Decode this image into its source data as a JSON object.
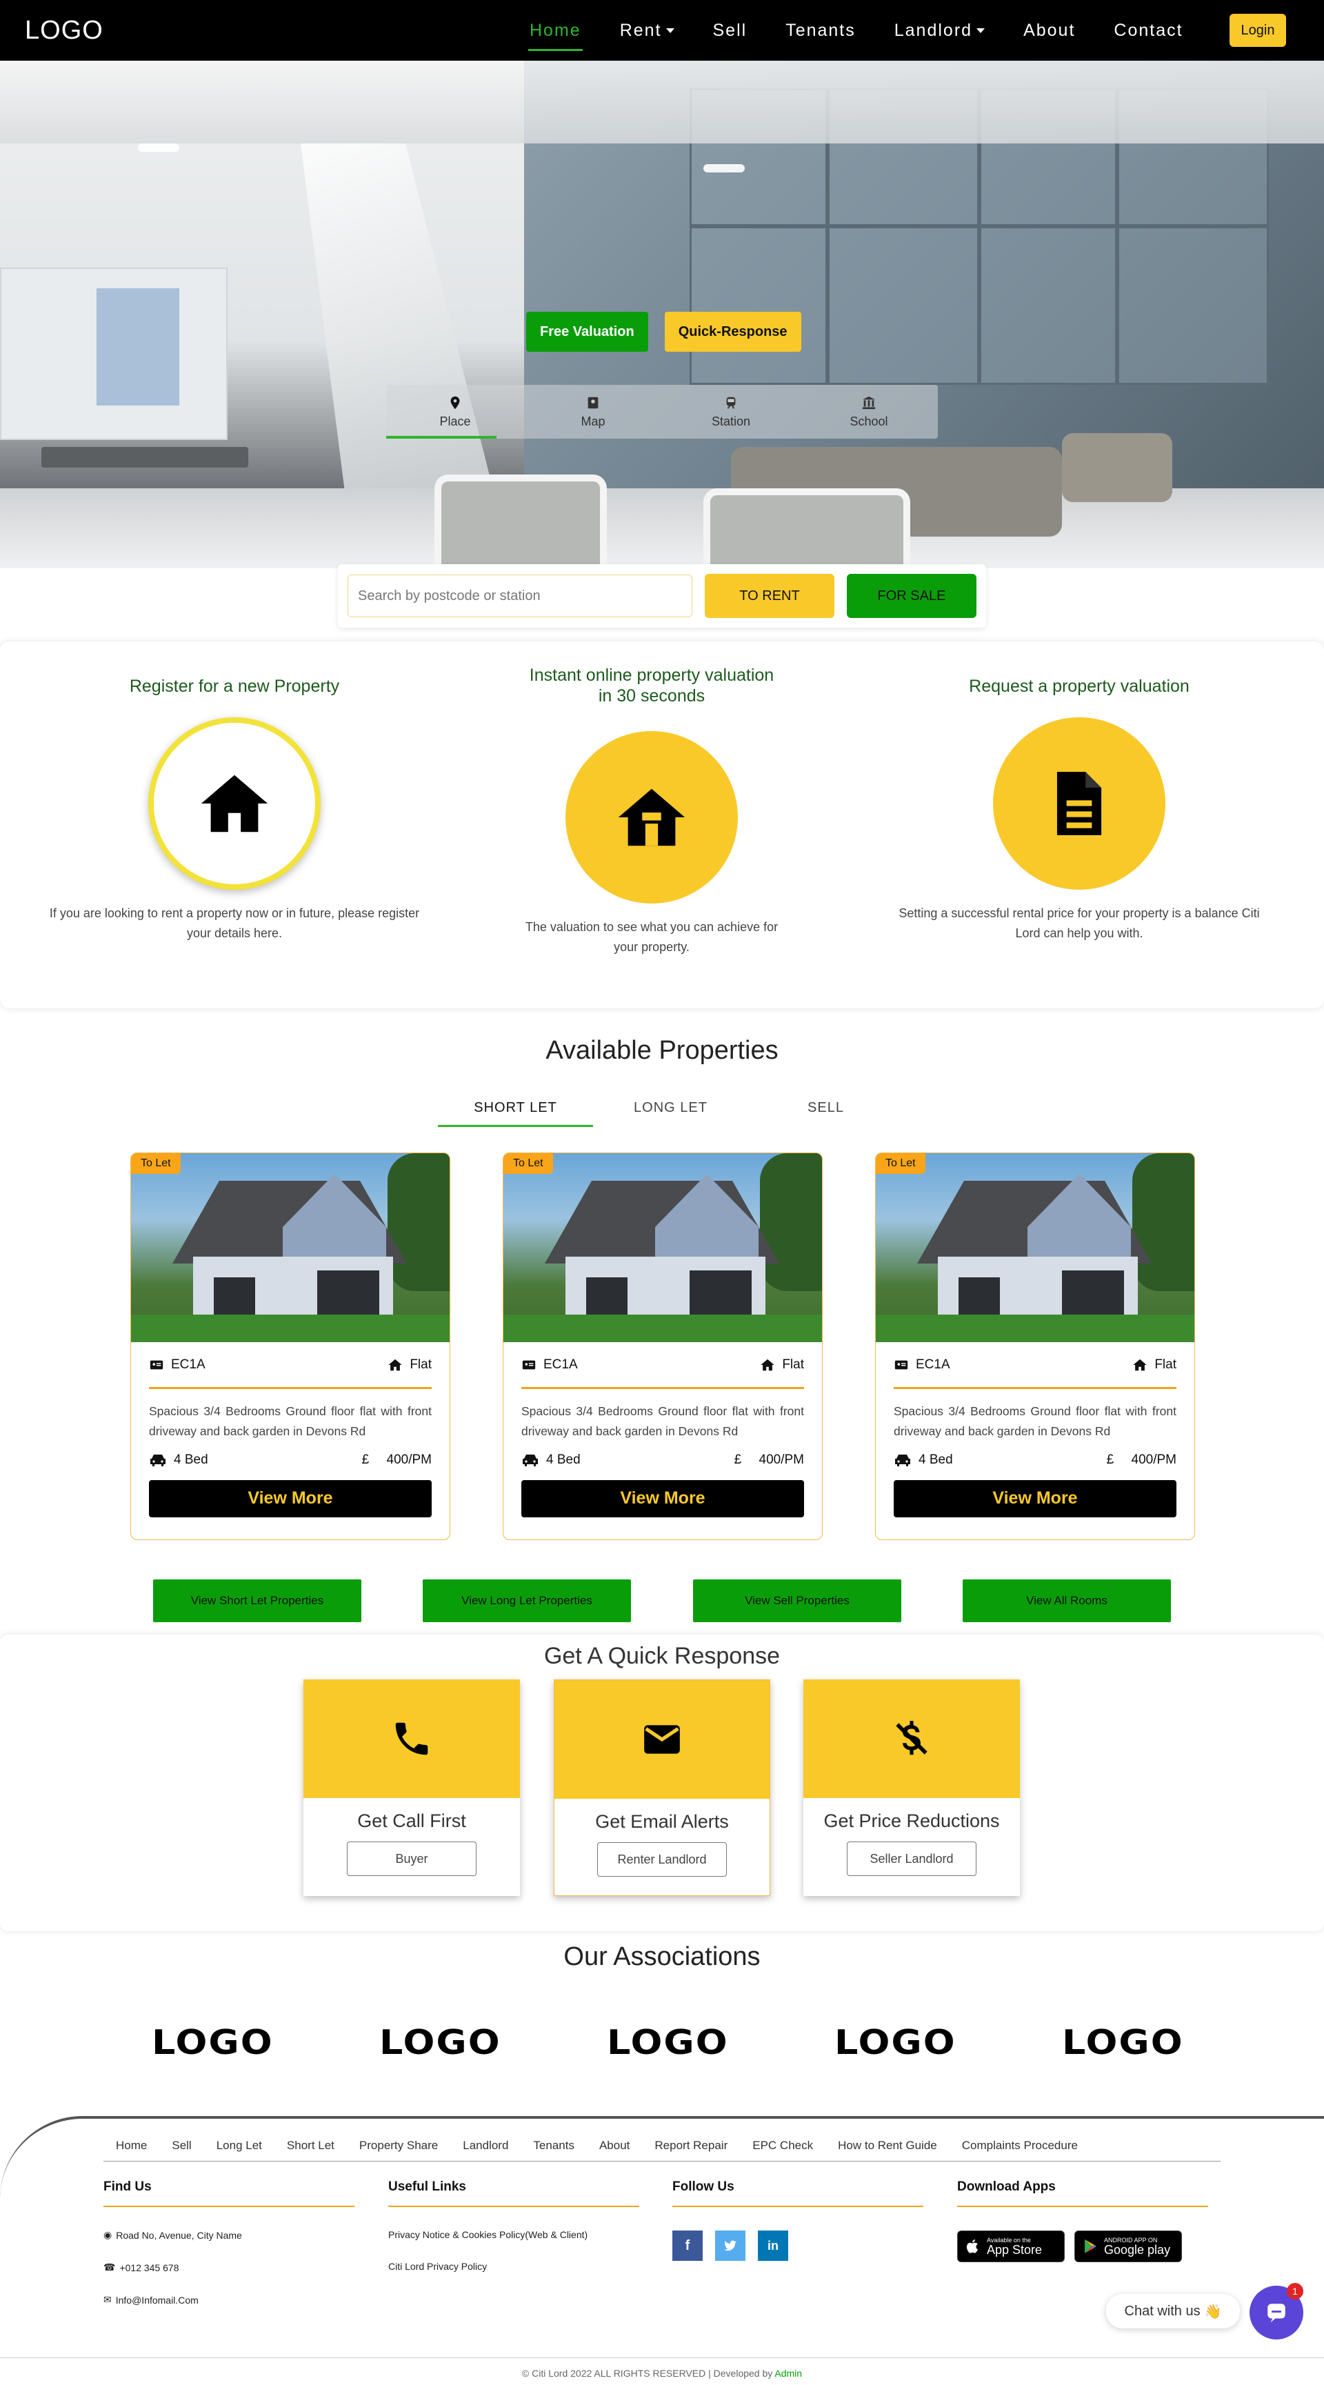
{
  "nav": {
    "logo": "LOGO",
    "items": [
      {
        "label": "Home",
        "caret": false
      },
      {
        "label": "Rent",
        "caret": true
      },
      {
        "label": "Sell",
        "caret": false
      },
      {
        "label": "Tenants",
        "caret": false
      },
      {
        "label": "Landlord",
        "caret": true
      },
      {
        "label": "About",
        "caret": false
      },
      {
        "label": "Contact",
        "caret": false
      }
    ],
    "login": "Login",
    "active_color": "#2fb52f"
  },
  "hero": {
    "free_valuation": "Free Valuation",
    "quick_response": "Quick-Response",
    "tabs": [
      "Place",
      "Map",
      "Station",
      "School"
    ]
  },
  "search": {
    "placeholder": "Search by postcode or station",
    "to_rent": "TO RENT",
    "for_sale": "FOR SALE"
  },
  "features": [
    {
      "title": "Register for a new Property",
      "icon": "house-icon",
      "text": "If you are looking to rent a property now or in future, please register your details here."
    },
    {
      "title": "Instant online property valuation in 30 seconds",
      "icon": "house-door-icon",
      "text": "The valuation to see what you can achieve for your property."
    },
    {
      "title": "Request a property valuation",
      "icon": "document-icon",
      "text": "Setting a successful rental price for your property is a balance Citi Lord can help you with."
    }
  ],
  "properties": {
    "title": "Available Properties",
    "tabs": [
      "SHORT LET",
      "LONG LET",
      "SELL"
    ],
    "cards": [
      {
        "badge": "To Let",
        "postcode": "EC1A",
        "type": "Flat",
        "description": "Spacious 3/4 Bedrooms Ground floor flat with front driveway and back garden in Devons Rd",
        "beds": "4 Bed",
        "currency": "£",
        "price": "400/PM",
        "button": "View More"
      },
      {
        "badge": "To Let",
        "postcode": "EC1A",
        "type": "Flat",
        "description": "Spacious 3/4 Bedrooms Ground floor flat with front driveway and back garden in Devons Rd",
        "beds": "4 Bed",
        "currency": "£",
        "price": "400/PM",
        "button": "View More"
      },
      {
        "badge": "To Let",
        "postcode": "EC1A",
        "type": "Flat",
        "description": "Spacious 3/4 Bedrooms Ground floor flat with front driveway and back garden in Devons Rd",
        "beds": "4 Bed",
        "currency": "£",
        "price": "400/PM",
        "button": "View More"
      }
    ],
    "buttons": [
      "View Short Let Properties",
      "View Long Let Properties",
      "View Sell Properties",
      "View All Rooms"
    ]
  },
  "quick": {
    "title": "Get A Quick Response",
    "cards": [
      {
        "title": "Get Call First",
        "button": "Buyer",
        "icon": "phone-icon"
      },
      {
        "title": "Get Email Alerts",
        "button": "Renter Landlord",
        "icon": "envelope-icon"
      },
      {
        "title": "Get Price Reductions",
        "button": "Seller Landlord",
        "icon": "dollar-slash-icon"
      }
    ]
  },
  "associations": {
    "title": "Our Associations",
    "logos": [
      "LOGO",
      "LOGO",
      "LOGO",
      "LOGO",
      "LOGO"
    ]
  },
  "footer": {
    "links": [
      "Home",
      "Sell",
      "Long Let",
      "Short Let",
      "Property Share",
      "Landlord",
      "Tenants",
      "About",
      "Report Repair",
      "EPC Check",
      "How to Rent Guide",
      "Complaints Procedure"
    ],
    "find_us": {
      "title": "Find Us",
      "address": "Road No, Avenue, City Name",
      "phone": "+012 345 678",
      "email": "Info@Infomail.Com"
    },
    "useful": {
      "title": "Useful Links",
      "items": [
        "Privacy Notice & Cookies Policy(Web & Client)",
        "Citi Lord Privacy Policy"
      ]
    },
    "follow": {
      "title": "Follow Us",
      "social": [
        "facebook-icon",
        "twitter-icon",
        "linkedin-icon"
      ]
    },
    "apps": {
      "title": "Download Apps",
      "app_store_small": "Available on the",
      "app_store_big": "App Store",
      "google_small": "ANDROID APP ON",
      "google_big": "Google play"
    },
    "copyright": "© Citi Lord 2022 ALL RIGHTS RESERVED | Developed by",
    "developer": "Admin"
  },
  "chat": {
    "label": "Chat with us",
    "emoji": "👋",
    "badge": "1"
  },
  "colors": {
    "yellow": "#f9c92a",
    "green": "#0a9d0a",
    "orange": "#f3a21a",
    "black": "#000000"
  }
}
